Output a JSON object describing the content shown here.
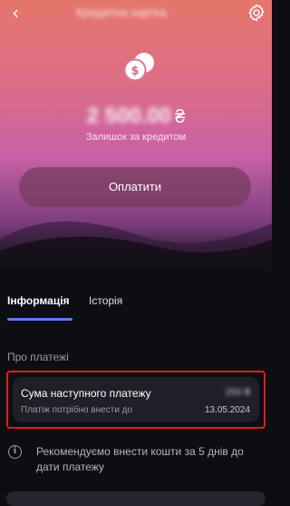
{
  "header": {
    "back_icon": "chevron-left-icon",
    "title": "Кредитна картка",
    "settings_icon": "gear-icon"
  },
  "balance": {
    "amount": "2 500.00",
    "currency": "₴",
    "label": "Залишок за кредитом"
  },
  "actions": {
    "pay_label": "Оплатити"
  },
  "tabs": [
    {
      "label": "Інформація",
      "active": true
    },
    {
      "label": "Історія",
      "active": false
    }
  ],
  "payments": {
    "section_title": "Про платежі",
    "next_payment": {
      "label": "Сума наступного платежу",
      "amount": "250 ₴",
      "sub_label": "Платіж потрібно внести до",
      "date": "13.05.2024"
    }
  },
  "info": {
    "icon": "info-icon",
    "text": "Рекомендуємо внести кошти за 5 днів до дати платежу"
  },
  "colors": {
    "hero_top": "#e5766b",
    "hero_mid": "#c860a6",
    "background": "#0d0d12",
    "tab_accent": "#5b7bff",
    "highlight_border": "#d81f1f"
  }
}
